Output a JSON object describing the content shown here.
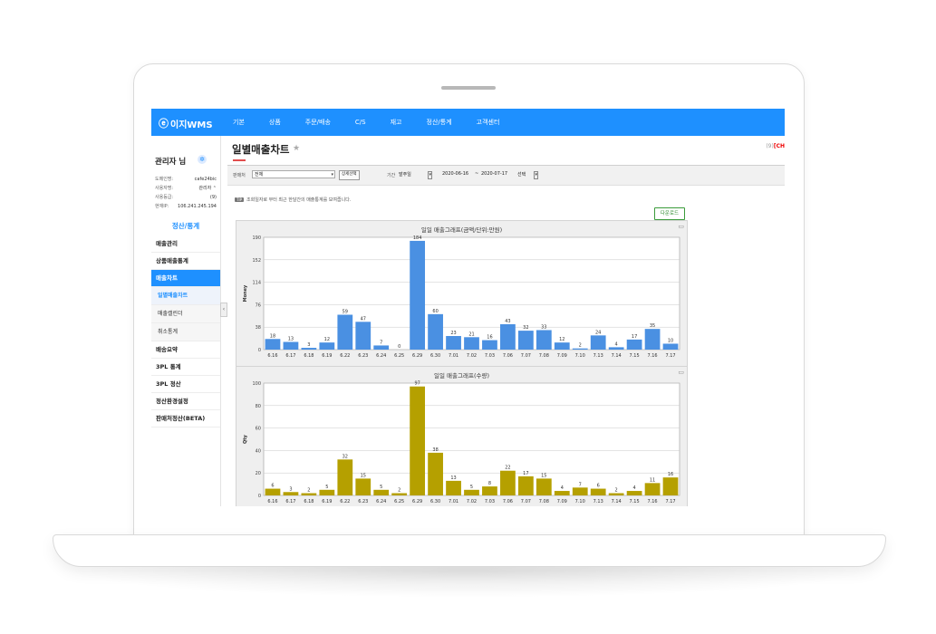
{
  "nav": {
    "logo": "이지WMS",
    "items": [
      "기본",
      "상품",
      "주문/배송",
      "C/S",
      "재고",
      "정산/통계",
      "고객센터"
    ]
  },
  "sidebar": {
    "user_name": "관리자 님",
    "info": [
      {
        "k": "도메인명:",
        "v": "cafe24bic"
      },
      {
        "k": "사용자명:",
        "v": "관리자 ⌃"
      },
      {
        "k": "사용등급:",
        "v": "(9)"
      },
      {
        "k": "현재IP:",
        "v": "106.241.245.194"
      }
    ],
    "section_title": "정산/통계",
    "menu": [
      {
        "label": "매출관리",
        "kind": "main"
      },
      {
        "label": "상품매출통계",
        "kind": "main"
      },
      {
        "label": "매출차트",
        "kind": "active"
      },
      {
        "label": "일별매출차트",
        "kind": "current"
      },
      {
        "label": "매출캘린더",
        "kind": "sub"
      },
      {
        "label": "취소통계",
        "kind": "sub"
      },
      {
        "label": "배송요약",
        "kind": "main"
      },
      {
        "label": "3PL 통계",
        "kind": "main"
      },
      {
        "label": "3PL 정산",
        "kind": "main"
      },
      {
        "label": "정산환경설정",
        "kind": "main"
      },
      {
        "label": "판매처정산(BETA)",
        "kind": "main"
      }
    ],
    "collapse_glyph": "‹"
  },
  "page": {
    "title": "일별매출차트",
    "star": "★",
    "corner_prefix": "(9)",
    "corner_highlight": "[CH"
  },
  "filters": {
    "seller_label": "판매처",
    "seller_value": "전체",
    "detail_button": "상세선택",
    "period_label": "기간",
    "period_type": "발주일",
    "date_from": "2020-06-16",
    "date_sep": "~",
    "date_to": "2020-07-17",
    "select_value": "선택"
  },
  "tip": {
    "badge": "TIP",
    "text": "조회일자로 부터 최근 한달간의 매출통계를 보여줍니다."
  },
  "download_label": "다운로드",
  "chart_data": [
    {
      "type": "bar",
      "title": "일일 매출그래프(금액/단위:만원)",
      "ylabel": "Money",
      "color": "#4a90e2",
      "ylim": [
        0,
        190
      ],
      "yticks": [
        0,
        38,
        76,
        114,
        152,
        190
      ],
      "grid": true,
      "categories": [
        "6.16",
        "6.17",
        "6.18",
        "6.19",
        "6.22",
        "6.23",
        "6.24",
        "6.25",
        "6.29",
        "6.30",
        "7.01",
        "7.02",
        "7.03",
        "7.06",
        "7.07",
        "7.08",
        "7.09",
        "7.10",
        "7.13",
        "7.14",
        "7.15",
        "7.16",
        "7.17"
      ],
      "values": [
        18,
        13,
        3,
        12,
        59,
        47,
        7,
        0,
        184,
        60,
        23,
        21,
        16,
        43,
        32,
        33,
        12,
        2,
        24,
        4,
        17,
        35,
        10
      ]
    },
    {
      "type": "bar",
      "title": "일일 매출그래프(수량)",
      "ylabel": "Qty",
      "color": "#b5a000",
      "ylim": [
        0,
        100
      ],
      "yticks": [
        0,
        20,
        40,
        60,
        80,
        100
      ],
      "grid": true,
      "categories": [
        "6.16",
        "6.17",
        "6.18",
        "6.19",
        "6.22",
        "6.23",
        "6.24",
        "6.25",
        "6.29",
        "6.30",
        "7.01",
        "7.02",
        "7.03",
        "7.06",
        "7.07",
        "7.08",
        "7.09",
        "7.10",
        "7.13",
        "7.14",
        "7.15",
        "7.16",
        "7.17"
      ],
      "values": [
        6,
        3,
        2,
        5,
        32,
        15,
        5,
        2,
        97,
        38,
        13,
        5,
        8,
        22,
        17,
        15,
        4,
        7,
        6,
        2,
        4,
        11,
        16
      ]
    }
  ],
  "colors": {
    "brand": "#1e90ff",
    "money_bar": "#4a90e2",
    "qty_bar": "#b5a000",
    "download": "#2e8b2e"
  },
  "icons": {
    "gear": "gear-icon",
    "print": "print-icon",
    "star": "star-icon"
  }
}
